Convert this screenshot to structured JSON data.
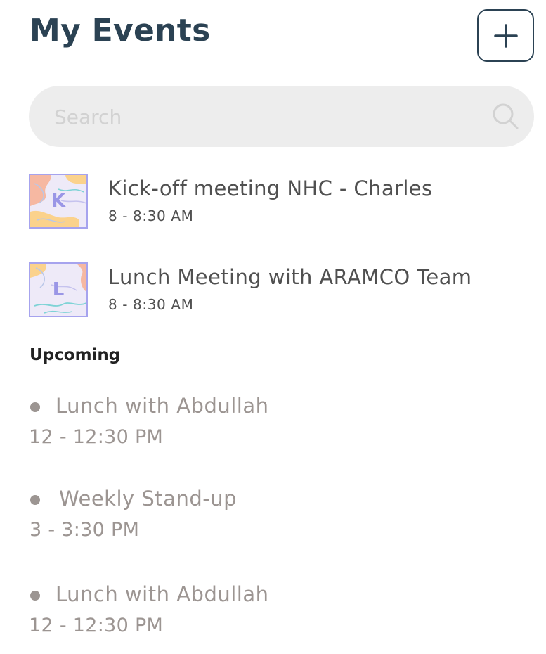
{
  "header": {
    "title": "My Events",
    "add_icon": "plus-icon"
  },
  "search": {
    "placeholder": "Search",
    "value": "",
    "icon": "search-icon"
  },
  "events": [
    {
      "thumb_letter": "K",
      "title": "Kick-off meeting NHC - Charles",
      "time": "8 - 8:30 AM"
    },
    {
      "thumb_letter": "L",
      "title": "Lunch Meeting with ARAMCO Team",
      "time": "8 - 8:30 AM"
    }
  ],
  "upcoming": {
    "label": "Upcoming",
    "items": [
      {
        "title": "Lunch with Abdullah",
        "time": "12 - 12:30 PM"
      },
      {
        "title": "Weekly Stand-up",
        "time": "3 - 3:30 PM"
      },
      {
        "title": "Lunch with Abdullah",
        "time": "12 - 12:30 PM"
      }
    ]
  },
  "colors": {
    "title": "#2b4253",
    "search_bg": "#ededed",
    "thumb_border": "#a6a3ee",
    "upcoming_text": "#9c9592"
  }
}
